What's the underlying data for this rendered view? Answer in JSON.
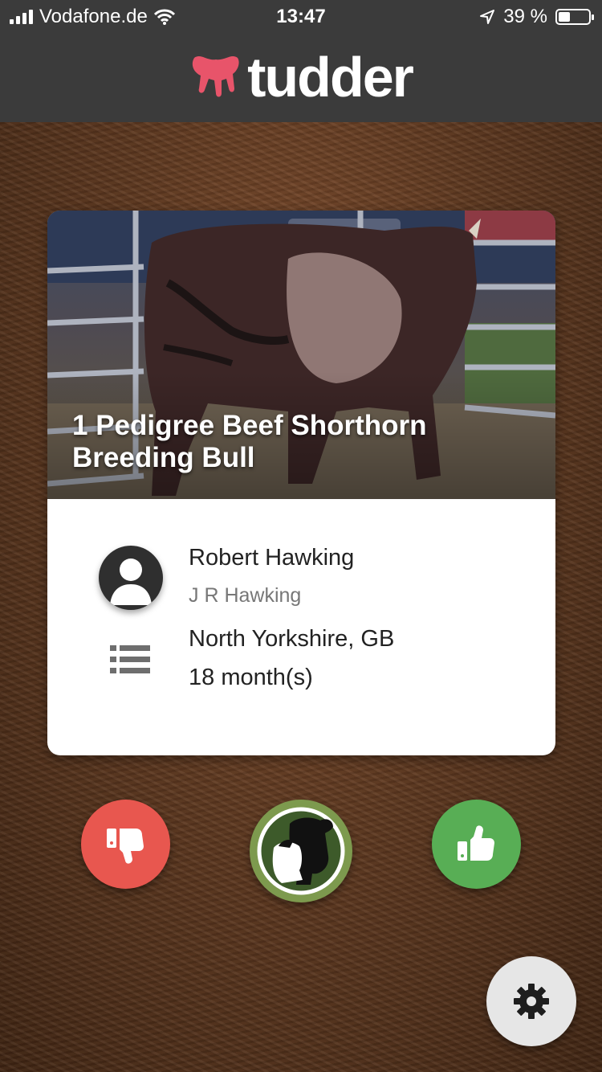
{
  "status_bar": {
    "carrier": "Vodafone.de",
    "time": "13:47",
    "battery_percent": "39 %",
    "battery_level": 0.39
  },
  "header": {
    "app_name": "tudder",
    "brand_color": "#e8546a"
  },
  "listing": {
    "title": "1 Pedigree Beef Shorthorn Breeding Bull",
    "owner_name": "Robert Hawking",
    "owner_company": "J R Hawking",
    "location": "North Yorkshire, GB",
    "age": "18 month(s)"
  },
  "actions": {
    "dislike_color": "#e8574f",
    "like_color": "#58ae55",
    "center_color": "#7d9a4e"
  },
  "icons": [
    "signal-icon",
    "wifi-icon",
    "location-arrow-icon",
    "battery-icon",
    "udder-logo-icon",
    "user-avatar-icon",
    "list-icon",
    "thumbs-down-icon",
    "cow-icon",
    "thumbs-up-icon",
    "gear-icon"
  ]
}
